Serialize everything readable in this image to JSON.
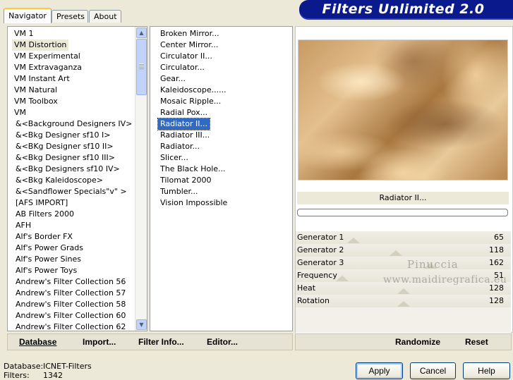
{
  "tabs": [
    {
      "label": "Navigator",
      "active": true
    },
    {
      "label": "Presets",
      "active": false
    },
    {
      "label": "About",
      "active": false
    }
  ],
  "banner": {
    "title": "Filters Unlimited 2.0"
  },
  "categories": [
    "VM 1",
    "VM Distortion",
    "VM Experimental",
    "VM Extravaganza",
    "VM Instant Art",
    "VM Natural",
    "VM Toolbox",
    "VM",
    "&<Background Designers IV>",
    "&<Bkg Designer sf10 I>",
    "&<BKg Designer sf10 II>",
    "&<Bkg Designer sf10 III>",
    "&<Bkg Designers sf10 IV>",
    "&<Bkg Kaleidoscope>",
    "&<Sandflower Specials\"v\" >",
    "[AFS IMPORT]",
    "AB Filters 2000",
    "AFH",
    "Alf's Border FX",
    "Alf's Power Grads",
    "Alf's Power Sines",
    "Alf's Power Toys",
    "Andrew's Filter Collection 56",
    "Andrew's Filter Collection 57",
    "Andrew's Filter Collection 58",
    "Andrew's Filter Collection 60",
    "Andrew's Filter Collection 62"
  ],
  "selected_category": "VM Distortion",
  "filters": [
    "Broken Mirror...",
    "Center Mirror...",
    "Circulator II...",
    "Circulator...",
    "Gear...",
    "Kaleidoscope......",
    "Mosaic Ripple...",
    "Radial Pox...",
    "Radiator II...",
    "Radiator III...",
    "Radiator...",
    "Slicer...",
    "The Black Hole...",
    "Tilomat 2000",
    "Tumbler...",
    "Vision Impossible"
  ],
  "selected_filter": "Radiator II...",
  "preview": {
    "filter_name": "Radiator II...",
    "colors": [
      "#c89b62",
      "#e4c08f",
      "#a8763f",
      "#e8c99a"
    ]
  },
  "parameters": [
    {
      "label": "Generator 1",
      "value": 65
    },
    {
      "label": "Generator 2",
      "value": 118
    },
    {
      "label": "Generator 3",
      "value": 162
    },
    {
      "label": "Frequency",
      "value": 51
    },
    {
      "label": "Heat",
      "value": 128
    },
    {
      "label": "Rotation",
      "value": 128
    }
  ],
  "watermark": {
    "line1": "Pinuccia",
    "line2": "www.maidiregrafica.eu"
  },
  "toolbar": {
    "database": "Database",
    "import": "Import...",
    "filter_info": "Filter Info...",
    "editor": "Editor...",
    "randomize": "Randomize",
    "reset": "Reset"
  },
  "status": {
    "database_label": "Database:",
    "database_value": "ICNET-Filters",
    "filters_label": "Filters:",
    "filters_value": "1342"
  },
  "buttons": {
    "apply": "Apply",
    "cancel": "Cancel",
    "help": "Help"
  }
}
